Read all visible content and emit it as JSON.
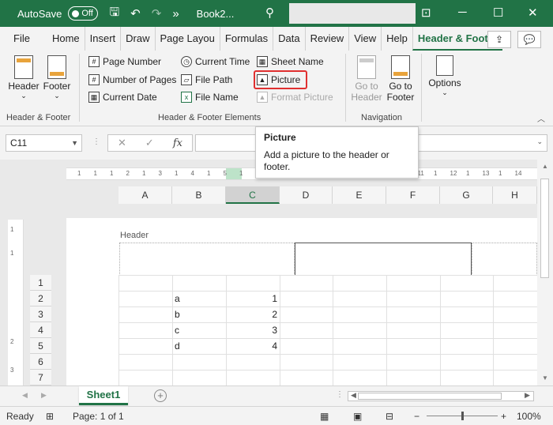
{
  "titlebar": {
    "autosave_label": "AutoSave",
    "autosave_state": "Off",
    "doc_name": "Book2...",
    "more_label": "»"
  },
  "tabs": [
    "File",
    "Home",
    "Insert",
    "Draw",
    "Page Layou",
    "Formulas",
    "Data",
    "Review",
    "View",
    "Help",
    "Header & Footer"
  ],
  "ribbon": {
    "group_hf": {
      "label": "Header & Footer",
      "header_btn": "Header",
      "footer_btn": "Footer"
    },
    "group_elements": {
      "label": "Header & Footer Elements",
      "page_number": "Page Number",
      "number_of_pages": "Number of Pages",
      "current_date": "Current Date",
      "current_time": "Current Time",
      "file_path": "File Path",
      "file_name": "File Name",
      "sheet_name": "Sheet Name",
      "picture": "Picture",
      "format_picture": "Format Picture"
    },
    "group_nav": {
      "label": "Navigation",
      "goto_header": "Go to Header",
      "goto_footer": "Go to Footer"
    },
    "options": "Options"
  },
  "formula_bar": {
    "name_box": "C11",
    "fx": "fx"
  },
  "tooltip": {
    "title": "Picture",
    "body": "Add a picture to the header or footer."
  },
  "sheet": {
    "columns": [
      "A",
      "B",
      "C",
      "D",
      "E",
      "F",
      "G",
      "H"
    ],
    "rows": [
      "1",
      "2",
      "3",
      "4",
      "5",
      "6",
      "7"
    ],
    "header_label": "Header",
    "ruler_h": [
      "1",
      "1",
      "1",
      "2",
      "1",
      "3",
      "1",
      "4",
      "1",
      "5",
      "1",
      "6",
      "1",
      "7",
      "1",
      "8",
      "1",
      "9",
      "1",
      "10",
      "1",
      "11",
      "1",
      "12",
      "1",
      "13",
      "1",
      "14"
    ],
    "ruler_v": [
      "1",
      "1",
      "2",
      "3"
    ],
    "cells": [
      {
        "row": "2",
        "b": "a",
        "c": "1"
      },
      {
        "row": "3",
        "b": "b",
        "c": "2"
      },
      {
        "row": "4",
        "b": "c",
        "c": "3"
      },
      {
        "row": "5",
        "b": "d",
        "c": "4"
      }
    ],
    "sheet_tab": "Sheet1"
  },
  "status": {
    "ready": "Ready",
    "page": "Page: 1 of 1",
    "zoom": "100%"
  },
  "colors": {
    "accent": "#217346",
    "highlight": "#e03030"
  }
}
